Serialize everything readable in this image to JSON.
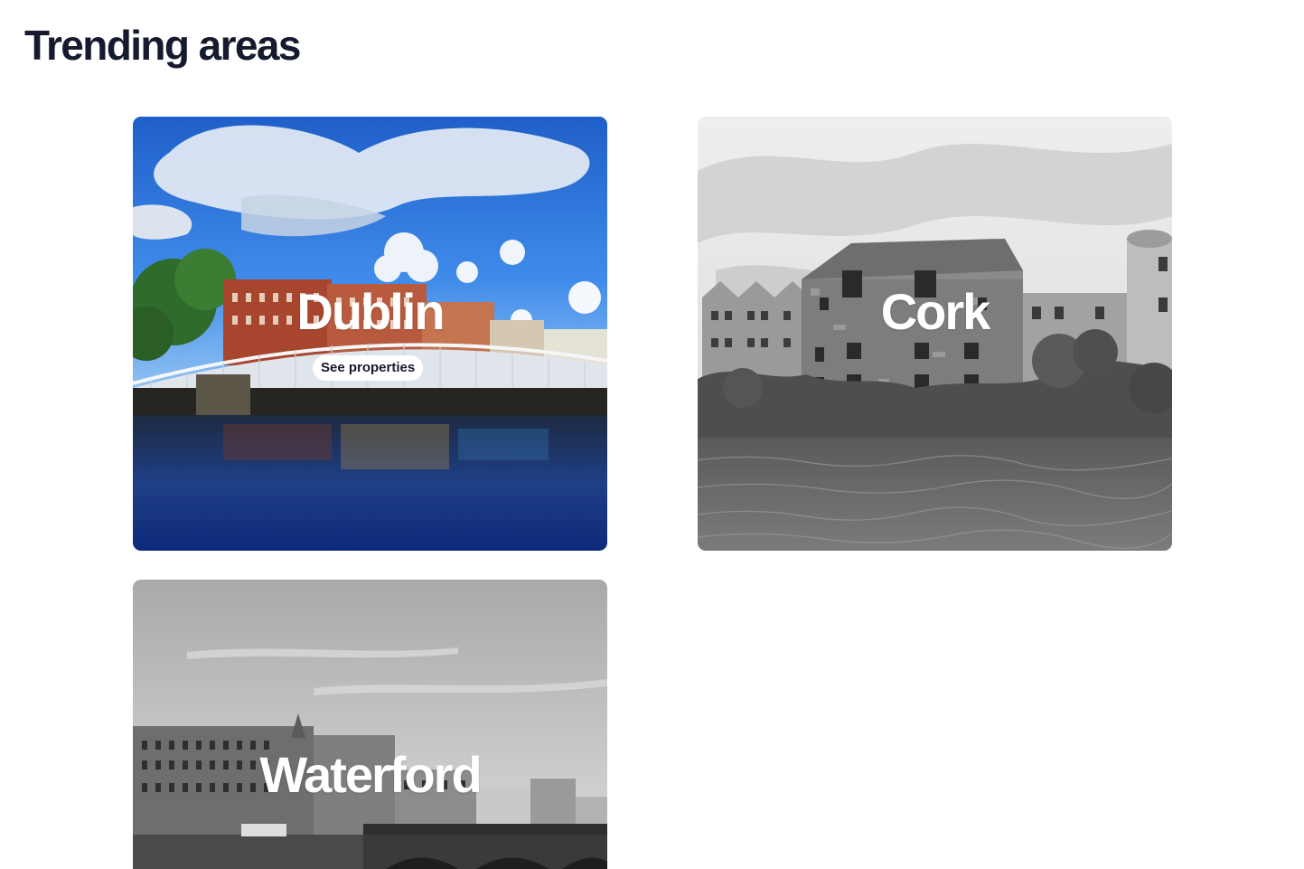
{
  "header": {
    "title": "Trending areas"
  },
  "colors": {
    "title_text": "#151a2e",
    "title_underline": "#5b98ef",
    "card_text": "#ffffff",
    "button_bg": "#ffffff"
  },
  "areas": [
    {
      "name": "Dublin",
      "image": "dublin-ha-penny-bridge-photo",
      "style": "color",
      "hover_button": "See properties"
    },
    {
      "name": "Cork",
      "image": "cork-riverside-buildings-photo",
      "style": "grayscale"
    },
    {
      "name": "Waterford",
      "image": "waterford-quay-photo",
      "style": "grayscale"
    }
  ]
}
